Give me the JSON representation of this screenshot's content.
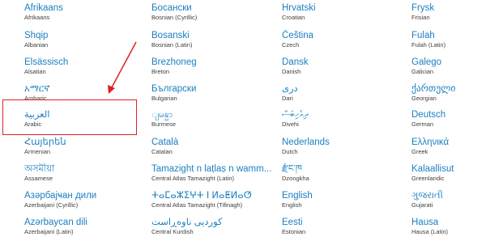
{
  "colors": {
    "native": "#1a7fc1",
    "english": "#404040",
    "highlight": "#e02020"
  },
  "columns": [
    [
      {
        "native": "Afrikaans",
        "english": "Afrikaans"
      },
      {
        "native": "Shqip",
        "english": "Albanian"
      },
      {
        "native": "Elsässisch",
        "english": "Alsatian"
      },
      {
        "native": "አማርኛ",
        "english": "Amharic"
      },
      {
        "native": "العربية",
        "english": "Arabic"
      },
      {
        "native": "Հայերեն",
        "english": "Armenian"
      },
      {
        "native": "অসমীয়া",
        "english": "Assamese"
      },
      {
        "native": "Азәрбајҹан дили",
        "english": "Azerbaijani (Cyrillic)"
      },
      {
        "native": "Azərbaycan dili",
        "english": "Azerbaijani (Latin)"
      }
    ],
    [
      {
        "native": "Босански",
        "english": "Bosnian (Cyrillic)"
      },
      {
        "native": "Bosanski",
        "english": "Bosnian (Latin)"
      },
      {
        "native": "Brezhoneg",
        "english": "Breton"
      },
      {
        "native": "Български",
        "english": "Bulgarian"
      },
      {
        "native": "ျမန္မာ",
        "english": "Burmese"
      },
      {
        "native": "Català",
        "english": "Catalan"
      },
      {
        "native": "Tamazight n laṭlaṣ n wamm...",
        "english": "Central Atlas Tamazight (Latin)"
      },
      {
        "native": "ⵜⴰⵎⴰⵣⵉⵖⵜ ⵏ ⵍⴰⵟⵍⴰⵚ",
        "english": "Central Atlas Tamazight (Tifinagh)"
      },
      {
        "native": "کوردیی ناوەڕاست",
        "english": "Central Kurdish"
      }
    ],
    [
      {
        "native": "Hrvatski",
        "english": "Croatian"
      },
      {
        "native": "Čeština",
        "english": "Czech"
      },
      {
        "native": "Dansk",
        "english": "Danish"
      },
      {
        "native": "دری",
        "english": "Dari"
      },
      {
        "native": "ދިވެހިބަސް",
        "english": "Divehi"
      },
      {
        "native": "Nederlands",
        "english": "Dutch"
      },
      {
        "native": "རྫོང་ཁ",
        "english": "Dzongkha"
      },
      {
        "native": "English",
        "english": "English"
      },
      {
        "native": "Eesti",
        "english": "Estonian"
      }
    ],
    [
      {
        "native": "Frysk",
        "english": "Frisian"
      },
      {
        "native": "Fulah",
        "english": "Fulah (Latin)"
      },
      {
        "native": "Galego",
        "english": "Galician"
      },
      {
        "native": "ქართული",
        "english": "Georgian"
      },
      {
        "native": "Deutsch",
        "english": "German"
      },
      {
        "native": "Ελληνικά",
        "english": "Greek"
      },
      {
        "native": "Kalaallisut",
        "english": "Greenlandic"
      },
      {
        "native": "ગુજરાતી",
        "english": "Gujarati"
      },
      {
        "native": "Hausa",
        "english": "Hausa (Latin)"
      }
    ]
  ]
}
